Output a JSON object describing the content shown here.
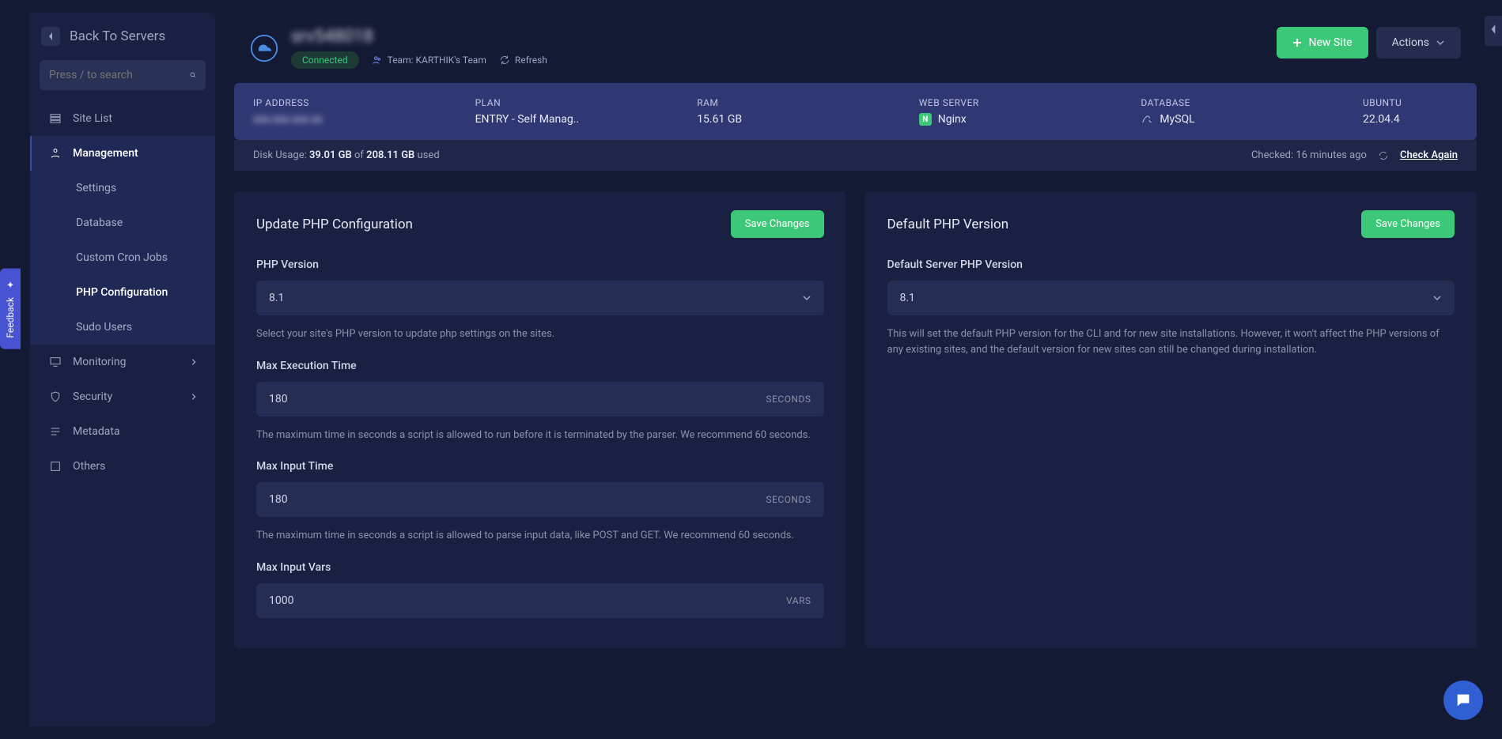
{
  "sidebar": {
    "back_label": "Back To Servers",
    "search_placeholder": "Press / to search",
    "items": {
      "site_list": "Site List",
      "management": "Management",
      "monitoring": "Monitoring",
      "security": "Security",
      "metadata": "Metadata",
      "others": "Others"
    },
    "management_sub": {
      "settings": "Settings",
      "database": "Database",
      "cron": "Custom Cron Jobs",
      "php": "PHP Configuration",
      "sudo": "Sudo Users"
    }
  },
  "top": {
    "server_name": "srv548018",
    "status": "Connected",
    "team_prefix": "Team: ",
    "team_name": "KARTHIK's Team",
    "refresh": "Refresh",
    "new_site": "New Site",
    "actions": "Actions"
  },
  "stats": {
    "ip_label": "IP ADDRESS",
    "ip_value": "xxx.xxx.xxx.xx",
    "plan_label": "PLAN",
    "plan_value": "ENTRY - Self Manag..",
    "ram_label": "RAM",
    "ram_value": "15.61 GB",
    "ws_label": "WEB SERVER",
    "ws_value": "Nginx",
    "db_label": "DATABASE",
    "db_value": "MySQL",
    "os_label": "UBUNTU",
    "os_value": "22.04.4"
  },
  "disk": {
    "prefix": "Disk Usage: ",
    "used": "39.01 GB",
    "of": " of ",
    "total": "208.11 GB",
    "suffix": " used",
    "checked_prefix": "Checked: ",
    "checked_time": "16 minutes ago",
    "check_again": "Check Again"
  },
  "card_left": {
    "title": "Update PHP Configuration",
    "save": "Save Changes",
    "php_version_label": "PHP Version",
    "php_version_value": "8.1",
    "php_version_help": "Select your site's PHP version to update php settings on the sites.",
    "max_exec_label": "Max Execution Time",
    "max_exec_value": "180",
    "seconds_suffix": "SECONDS",
    "max_exec_help": "The maximum time in seconds a script is allowed to run before it is terminated by the parser. We recommend 60 seconds.",
    "max_input_time_label": "Max Input Time",
    "max_input_time_value": "180",
    "max_input_time_help": "The maximum time in seconds a script is allowed to parse input data, like POST and GET. We recommend 60 seconds.",
    "max_input_vars_label": "Max Input Vars",
    "max_input_vars_value": "1000",
    "vars_suffix": "VARS"
  },
  "card_right": {
    "title": "Default PHP Version",
    "save": "Save Changes",
    "default_label": "Default Server PHP Version",
    "default_value": "8.1",
    "default_help": "This will set the default PHP version for the CLI and for new site installations. However, it won't affect the PHP versions of any existing sites, and the default version for new sites can still be changed during installation."
  },
  "misc": {
    "feedback": "Feedback"
  }
}
